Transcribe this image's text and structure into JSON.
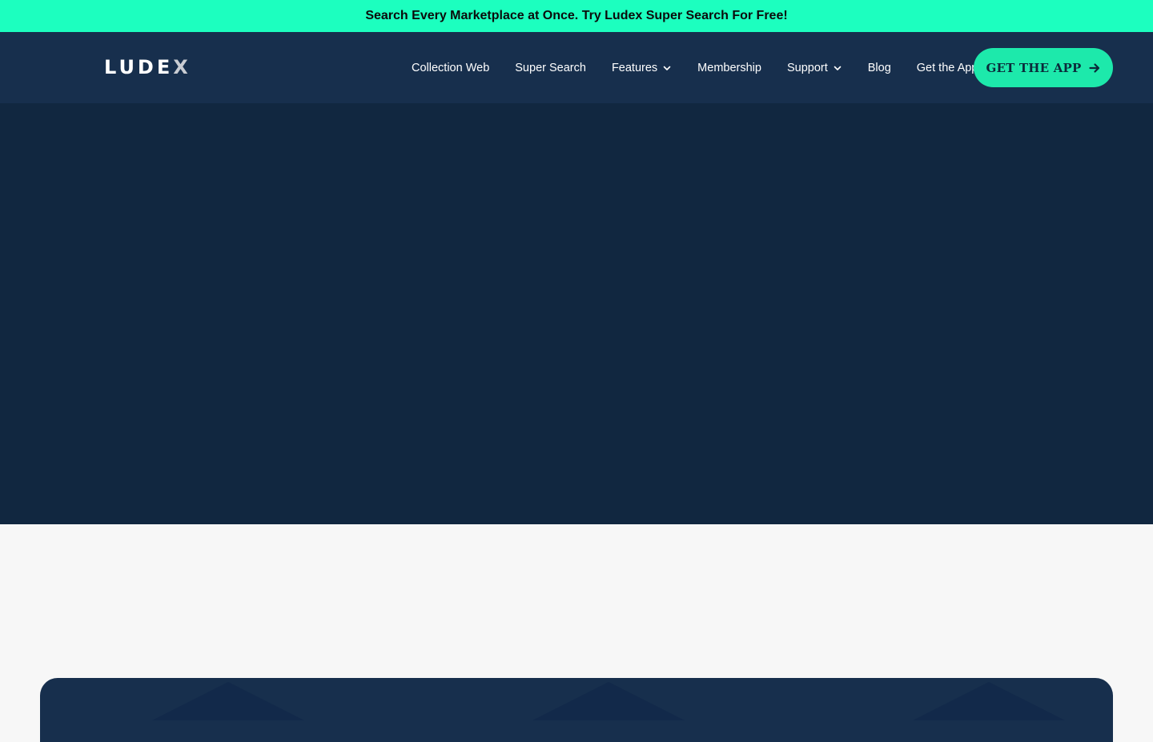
{
  "announcement": {
    "text": "Search Every Marketplace at Once. Try Ludex Super Search For Free!"
  },
  "header": {
    "logo": {
      "main": "LUDE",
      "accent": "X"
    },
    "nav": [
      {
        "label": "Collection Web",
        "has_dropdown": false
      },
      {
        "label": "Super Search",
        "has_dropdown": false
      },
      {
        "label": "Features",
        "has_dropdown": true
      },
      {
        "label": "Membership",
        "has_dropdown": false
      },
      {
        "label": "Support",
        "has_dropdown": true
      },
      {
        "label": "Blog",
        "has_dropdown": false
      },
      {
        "label": "Get the App",
        "has_dropdown": false
      }
    ],
    "cta_label": "GET THE APP"
  },
  "colors": {
    "announcement_bg": "#1cffbf",
    "header_bg": "#172f4d",
    "hero_bg": "#112740",
    "cta_bg": "#1de9ab",
    "page_bg": "#f7f7f7"
  }
}
